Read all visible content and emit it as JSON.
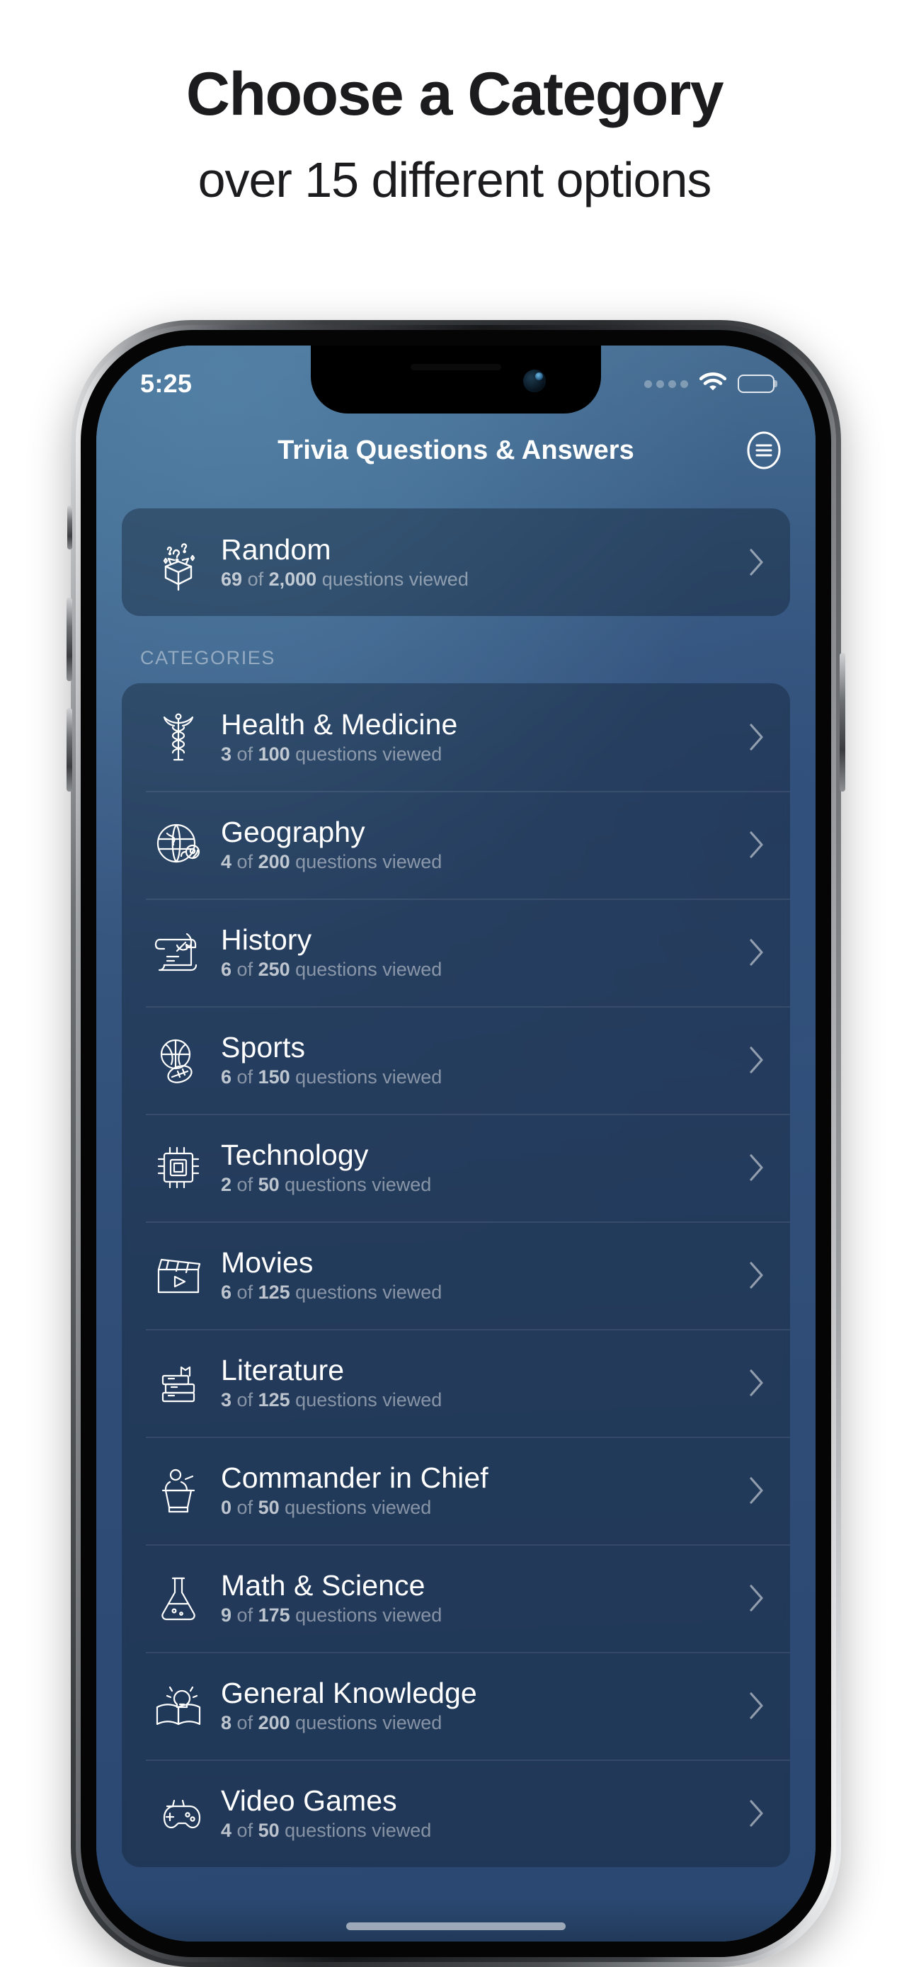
{
  "promo": {
    "title": "Choose a Category",
    "subtitle": "over 15 different options"
  },
  "phone": {
    "status": {
      "time": "5:25",
      "signal_icon": "signal-dots-icon",
      "wifi_icon": "wifi-icon",
      "battery_icon": "battery-full-icon"
    },
    "nav": {
      "title": "Trivia Questions & Answers",
      "menu_icon": "hamburger-menu-icon"
    },
    "random": {
      "icon": "mystery-box-icon",
      "title": "Random",
      "viewed": "69",
      "total": "2,000",
      "suffix": "questions viewed",
      "of": "of",
      "chevron_icon": "chevron-right-icon"
    },
    "section_header": "CATEGORIES",
    "categories": [
      {
        "icon": "caduceus-icon",
        "title": "Health & Medicine",
        "viewed": "3",
        "total": "100"
      },
      {
        "icon": "globe-pin-icon",
        "title": "Geography",
        "viewed": "4",
        "total": "200"
      },
      {
        "icon": "scroll-quill-icon",
        "title": "History",
        "viewed": "6",
        "total": "250"
      },
      {
        "icon": "sports-balls-icon",
        "title": "Sports",
        "viewed": "6",
        "total": "150"
      },
      {
        "icon": "microchip-icon",
        "title": "Technology",
        "viewed": "2",
        "total": "50"
      },
      {
        "icon": "clapperboard-icon",
        "title": "Movies",
        "viewed": "6",
        "total": "125"
      },
      {
        "icon": "books-stack-icon",
        "title": "Literature",
        "viewed": "3",
        "total": "125"
      },
      {
        "icon": "podium-icon",
        "title": "Commander in Chief",
        "viewed": "0",
        "total": "50"
      },
      {
        "icon": "flask-icon",
        "title": "Math & Science",
        "viewed": "9",
        "total": "175"
      },
      {
        "icon": "open-book-idea-icon",
        "title": "General Knowledge",
        "viewed": "8",
        "total": "200"
      },
      {
        "icon": "gamepad-icon",
        "title": "Video Games",
        "viewed": "4",
        "total": "50"
      }
    ],
    "row_of_label": "of",
    "row_suffix": "questions viewed"
  },
  "colors": {
    "screen_top": "#4a7195",
    "screen_bottom": "#2a4871",
    "card": "rgba(18,34,52,0.42)",
    "text_primary": "#ffffff",
    "text_secondary": "rgba(255,255,255,0.46)",
    "promo_text": "#1c1c1e"
  }
}
